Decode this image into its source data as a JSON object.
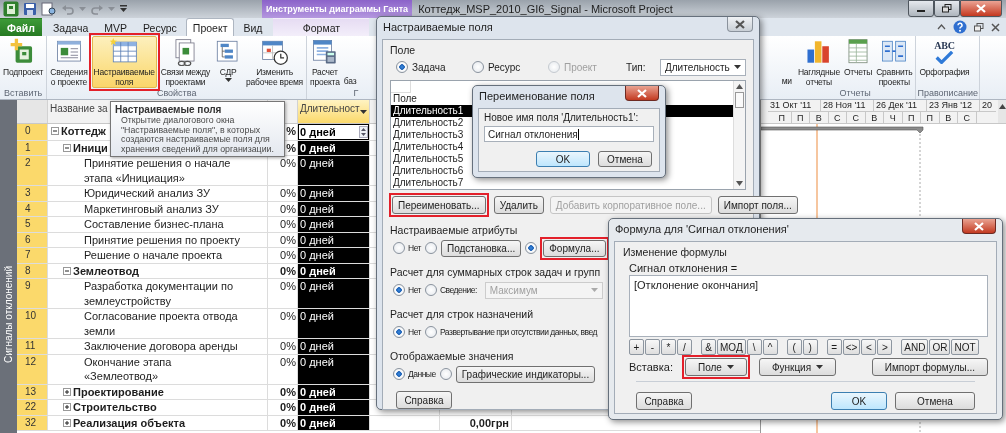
{
  "title_bar": {
    "contextual_tab": "Инструменты диаграммы Ганта",
    "title": "Коттедж_MSP_2010_GI6_Signal - Microsoft Project"
  },
  "tabs": [
    {
      "label": "Файл",
      "kind": "file",
      "selected": false
    },
    {
      "label": "Задача",
      "kind": "normal",
      "selected": false
    },
    {
      "label": "MVP",
      "kind": "normal",
      "selected": false
    },
    {
      "label": "Ресурс",
      "kind": "normal",
      "selected": false
    },
    {
      "label": "Проект",
      "kind": "normal",
      "selected": true
    },
    {
      "label": "Вид",
      "kind": "normal",
      "selected": false
    },
    {
      "label": "Формат",
      "kind": "contextual",
      "selected": false
    }
  ],
  "ribbon": {
    "groups": [
      {
        "label": "Вставить",
        "commands": [
          {
            "label": "Подпроект",
            "highlighted": false,
            "marked": false,
            "dropdown": false
          }
        ]
      },
      {
        "label": "Свойства",
        "commands": [
          {
            "label": "Сведения\nо проекте",
            "highlighted": false,
            "marked": false,
            "dropdown": false
          },
          {
            "label": "Настраиваемые\nполя",
            "highlighted": true,
            "marked": true,
            "dropdown": false
          },
          {
            "label": "Связи между\nпроектами",
            "highlighted": false,
            "marked": false,
            "dropdown": false
          },
          {
            "label": "СДР",
            "highlighted": false,
            "marked": false,
            "dropdown": true
          },
          {
            "label": "Изменить\nрабочее время",
            "highlighted": false,
            "marked": false,
            "dropdown": false
          }
        ]
      },
      {
        "label": "Г",
        "commands": [
          {
            "label": "Расчет\nпроекта",
            "highlighted": false,
            "marked": false,
            "dropdown": false
          },
          {
            "label": "баз",
            "highlighted": false,
            "marked": false,
            "dropdown": false
          }
        ]
      },
      {
        "commands": [
          {
            "label": "ми",
            "highlighted": false,
            "marked": false,
            "dropdown": false
          }
        ]
      },
      {
        "label": "Отчеты",
        "commands": [
          {
            "label": "Наглядные\nотчеты",
            "highlighted": false,
            "marked": false,
            "dropdown": false
          },
          {
            "label": "Отчеты",
            "highlighted": false,
            "marked": false,
            "dropdown": false
          },
          {
            "label": "Сравнить\nпроекты",
            "highlighted": false,
            "marked": false,
            "dropdown": false
          }
        ]
      },
      {
        "label": "Правописание",
        "commands": [
          {
            "label": "Орфография",
            "icon_text": "ABC",
            "highlighted": false,
            "marked": false,
            "dropdown": false
          }
        ]
      }
    ]
  },
  "view_bar": {
    "label": "Сигналы отклонений"
  },
  "table": {
    "columns": [
      {
        "label": "Название за",
        "kind": "name",
        "selected": false
      },
      {
        "label": "Длительност",
        "kind": "duration",
        "selected": true
      }
    ],
    "rows": [
      {
        "id": "0",
        "name": "Коттедж",
        "pct": "%",
        "duration": "0 дней",
        "kind": "summary",
        "expanded": true,
        "editing": true,
        "children": [
          {
            "id": "1",
            "name": "Иници",
            "pct": "%",
            "duration": "0 дней",
            "kind": "summary",
            "expanded": true,
            "editing": false,
            "children": [
              {
                "id": "2",
                "name": "Принятие решения о начале\nэтапа «Инициация»",
                "pct": "0%",
                "duration": "0 дней",
                "kind": "task",
                "editing": false
              },
              {
                "id": "3",
                "name": "Юридический анализ ЗУ",
                "pct": "0%",
                "duration": "0 дней",
                "kind": "task",
                "editing": false
              },
              {
                "id": "4",
                "name": "Маркетинговый анализ ЗУ",
                "pct": "0%",
                "duration": "0 дней",
                "kind": "task",
                "editing": false
              },
              {
                "id": "5",
                "name": "Составление бизнес-плана",
                "pct": "0%",
                "duration": "0 дней",
                "kind": "task",
                "editing": false
              },
              {
                "id": "6",
                "name": "Принятие решения по проекту",
                "pct": "0%",
                "duration": "0 дней",
                "kind": "task",
                "editing": false
              },
              {
                "id": "7",
                "name": "Решение о начале проекта",
                "pct": "0%",
                "duration": "0 дней",
                "kind": "task",
                "editing": false
              }
            ]
          },
          {
            "id": "8",
            "name": "Землеотвод",
            "pct": "0%",
            "duration": "0 дней",
            "kind": "summary",
            "expanded": true,
            "editing": false,
            "children": [
              {
                "id": "9",
                "name": "Разработка документации по\nземлеустройству",
                "pct": "0%",
                "duration": "0 дней",
                "kind": "task",
                "editing": false
              },
              {
                "id": "10",
                "name": "Согласование проекта отвода\nземли",
                "pct": "0%",
                "duration": "0 дней",
                "kind": "task",
                "editing": false
              },
              {
                "id": "11",
                "name": "Заключение договора аренды",
                "pct": "0%",
                "duration": "0 дней",
                "kind": "task",
                "editing": false
              },
              {
                "id": "12",
                "name": "Окончание этапа\n«Землеотвод»",
                "pct": "0%",
                "duration": "0 дней",
                "kind": "task",
                "editing": false
              }
            ]
          },
          {
            "id": "13",
            "name": "Проектирование",
            "pct": "0%",
            "duration": "0 дней",
            "kind": "summary",
            "expanded": false,
            "editing": false
          },
          {
            "id": "22",
            "name": "Строительство",
            "pct": "0%",
            "duration": "0 дней",
            "kind": "summary",
            "expanded": false,
            "editing": false
          },
          {
            "id": "32",
            "name": "Реализация объекта",
            "pct": "0%",
            "duration": "0 дней",
            "kind": "summary",
            "expanded": false,
            "editing": false,
            "cost": "0,00грн"
          }
        ]
      }
    ]
  },
  "gantt": {
    "months": [
      "31 Окт '11",
      "28 Ноя '11",
      "26 Дек '11",
      "23 Янв '12",
      "20"
    ],
    "days": [
      "П",
      "П",
      "В",
      "С",
      "С",
      "В",
      "Ч",
      "П",
      "П",
      "В",
      "С"
    ]
  },
  "tooltip": {
    "title": "Настраиваемые поля",
    "text": "Открытие диалогового окна \"Настраиваемые поля\", в которых создаются настраиваемые поля для хранения сведений для организации."
  },
  "custom_fields_dialog": {
    "title": "Настраиваемые поля",
    "field_group": "Поле",
    "entity_options": [
      {
        "label": "Задача",
        "selected": true,
        "disabled": false
      },
      {
        "label": "Ресурс",
        "selected": false,
        "disabled": false
      },
      {
        "label": "Проект",
        "selected": false,
        "disabled": true
      }
    ],
    "type_label": "Тип:",
    "type_value": "Длительность",
    "list_header": "Поле",
    "fields": [
      {
        "label": "Длительность1",
        "selected": true
      },
      {
        "label": "Длительность2",
        "selected": false
      },
      {
        "label": "Длительность3",
        "selected": false
      },
      {
        "label": "Длительность4",
        "selected": false
      },
      {
        "label": "Длительность5",
        "selected": false
      },
      {
        "label": "Длительность6",
        "selected": false
      },
      {
        "label": "Длительность7",
        "selected": false
      }
    ],
    "buttons": [
      {
        "label": "Переименовать...",
        "disabled": false,
        "marked": true
      },
      {
        "label": "Удалить",
        "disabled": false,
        "marked": false
      },
      {
        "label": "Добавить корпоративное поле...",
        "disabled": true,
        "marked": false
      },
      {
        "label": "Импорт поля...",
        "disabled": false,
        "marked": false
      }
    ],
    "sections": [
      {
        "label": "Настраиваемые атрибуты",
        "items": [
          {
            "kind": "radio",
            "label": "Нет",
            "selected": false
          },
          {
            "kind": "radio",
            "selected": false
          },
          {
            "kind": "button",
            "label": "Подстановка...",
            "marked": false
          },
          {
            "kind": "radio",
            "selected": true
          },
          {
            "kind": "button",
            "label": "Формула...",
            "marked": true
          }
        ]
      },
      {
        "label": "Расчет для суммарных строк задач и групп",
        "items": [
          {
            "kind": "radio",
            "label": "Нет",
            "selected": true
          },
          {
            "kind": "radio",
            "label": "Сведение:",
            "selected": false
          },
          {
            "kind": "dropdown",
            "value": "Максимум",
            "disabled": true
          }
        ]
      },
      {
        "label": "Расчет для строк назначений",
        "items": [
          {
            "kind": "radio",
            "label": "Нет",
            "selected": true
          },
          {
            "kind": "radio",
            "label": "Развертывание при отсутствии данных, введ",
            "selected": false
          }
        ]
      },
      {
        "label": "Отображаемые значения",
        "items": [
          {
            "kind": "radio",
            "label": "Данные",
            "selected": true
          },
          {
            "kind": "radio",
            "selected": false
          },
          {
            "kind": "button",
            "label": "Графические индикаторы...",
            "marked": false
          }
        ]
      }
    ],
    "help_button": "Справка"
  },
  "rename_dialog": {
    "title": "Переименование поля",
    "prompt": "Новое имя поля 'Длительность1':",
    "value": "Сигнал отклонения",
    "buttons": [
      {
        "label": "OK",
        "default": true
      },
      {
        "label": "Отмена",
        "default": false
      }
    ]
  },
  "formula_dialog": {
    "title": "Формула для 'Сигнал отклонения'",
    "group": "Изменение формулы",
    "formula_label": "Сигнал отклонения =",
    "formula": "[Отклонение окончания]",
    "operators": [
      [
        "+",
        "-",
        "*",
        "/"
      ],
      [
        "&",
        "МОД",
        "\\",
        "^"
      ],
      [
        "(",
        ")"
      ],
      [
        "=",
        "<>",
        "<",
        ">"
      ],
      [
        "AND",
        "OR",
        "NOT"
      ]
    ],
    "insert_label": "Вставка:",
    "insert_buttons": [
      {
        "label": "Поле",
        "dropdown": true,
        "marked": true
      },
      {
        "label": "Функция",
        "dropdown": true,
        "marked": false
      },
      {
        "label": "Импорт формулы...",
        "dropdown": false,
        "marked": false
      }
    ],
    "help_button": "Справка",
    "buttons": [
      {
        "label": "OK",
        "default": true
      },
      {
        "label": "Отмена",
        "default": false
      }
    ]
  }
}
